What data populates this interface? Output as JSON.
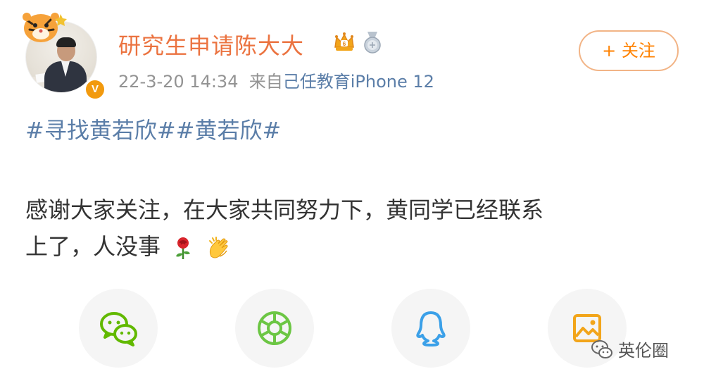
{
  "post": {
    "username": "研究生申请陈大大",
    "timestamp": "22-3-20 14:34",
    "source_prefix": "来自",
    "source_name": "己任教育iPhone 12",
    "follow_label": "+ 关注",
    "hashtags": [
      "#寻找黄若欣#",
      "#黄若欣#"
    ],
    "content_line1": "感谢大家关注，在大家共同努力下，黄同学已经联系",
    "content_line2": "上了，人没事",
    "emojis": [
      "rose-emoji",
      "clapping-hands-emoji"
    ],
    "verified_badge": "V"
  },
  "share": {
    "buttons": [
      {
        "name": "wechat-icon",
        "color": "#62b900"
      },
      {
        "name": "moments-icon",
        "color": "#6cc644"
      },
      {
        "name": "qq-icon",
        "color": "#3ba0e8"
      },
      {
        "name": "qzone-image-icon",
        "color": "#f2a51a"
      }
    ]
  },
  "watermark": {
    "text": "英伦圈"
  },
  "colors": {
    "username": "#eb7340",
    "link": "#5b7ea8",
    "meta": "#939393",
    "body_text": "#333333",
    "follow_accent": "#ff8200",
    "verified": "#f29a0e"
  }
}
